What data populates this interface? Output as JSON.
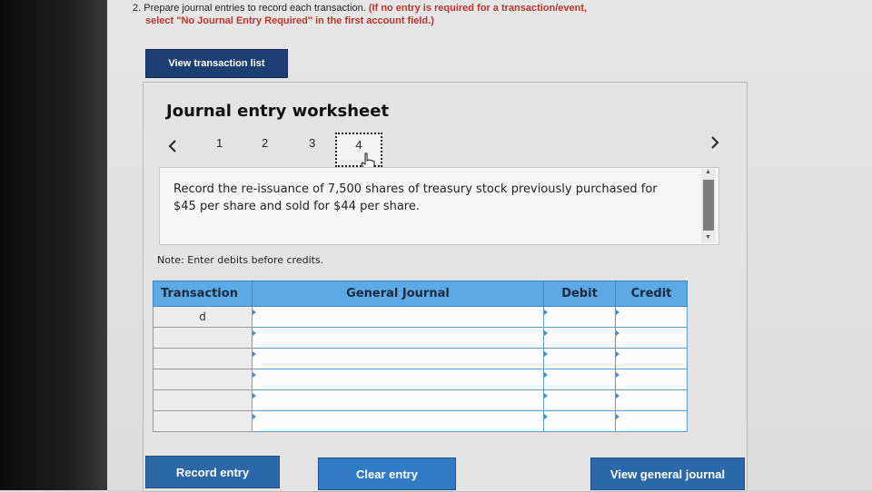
{
  "instructions": {
    "prefix": "2. Prepare journal entries to record each transaction.",
    "note_line1": "(If no entry is required for a transaction/event,",
    "note_line2": "select \"No Journal Entry Required\" in the first account field.)"
  },
  "view_transaction_list": "View transaction list",
  "worksheet": {
    "title": "Journal entry worksheet",
    "pages": [
      "1",
      "2",
      "3",
      "4"
    ],
    "active_page": "4",
    "prev_icon": "chevron-left-icon",
    "next_icon": "chevron-right-icon",
    "description": "Record the re-issuance of 7,500 shares of treasury stock previously purchased for $45 per share and sold for $44 per share.",
    "note": "Note: Enter debits before credits."
  },
  "table": {
    "headers": [
      "Transaction",
      "General Journal",
      "Debit",
      "Credit"
    ],
    "rows": [
      {
        "transaction": "d",
        "account": "",
        "debit": "",
        "credit": ""
      },
      {
        "transaction": "",
        "account": "",
        "debit": "",
        "credit": ""
      },
      {
        "transaction": "",
        "account": "",
        "debit": "",
        "credit": ""
      },
      {
        "transaction": "",
        "account": "",
        "debit": "",
        "credit": ""
      },
      {
        "transaction": "",
        "account": "",
        "debit": "",
        "credit": ""
      },
      {
        "transaction": "",
        "account": "",
        "debit": "",
        "credit": ""
      }
    ]
  },
  "buttons": {
    "record": "Record entry",
    "clear": "Clear entry",
    "view_journal": "View general journal"
  },
  "colors": {
    "button_blue": "#2c67a7",
    "header_blue": "#5da9e6",
    "instruction_red": "#c0342b"
  }
}
